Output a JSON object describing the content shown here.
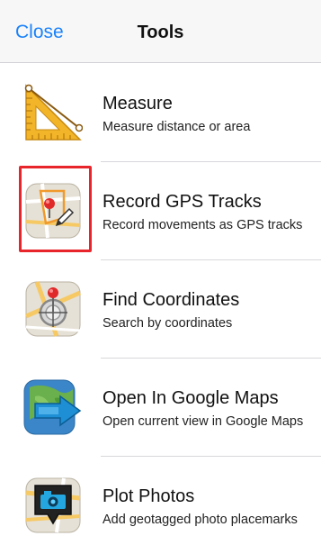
{
  "header": {
    "close_label": "Close",
    "title": "Tools",
    "accent_color": "#1a82fb"
  },
  "tools": [
    {
      "title": "Measure",
      "subtitle": "Measure distance or area",
      "icon": "set-square-icon"
    },
    {
      "title": "Record GPS Tracks",
      "subtitle": "Record movements as GPS tracks",
      "icon": "map-pin-pencil-icon",
      "highlighted": true
    },
    {
      "title": "Find Coordinates",
      "subtitle": "Search by coordinates",
      "icon": "crosshair-pin-icon"
    },
    {
      "title": "Open In Google Maps",
      "subtitle": "Open current view in Google Maps",
      "icon": "google-maps-arrow-icon"
    },
    {
      "title": "Plot Photos",
      "subtitle": "Add geotagged photo placemarks",
      "icon": "camera-pin-icon"
    }
  ],
  "colors": {
    "highlight": "#e8252b",
    "separator": "#d8d8dc"
  }
}
